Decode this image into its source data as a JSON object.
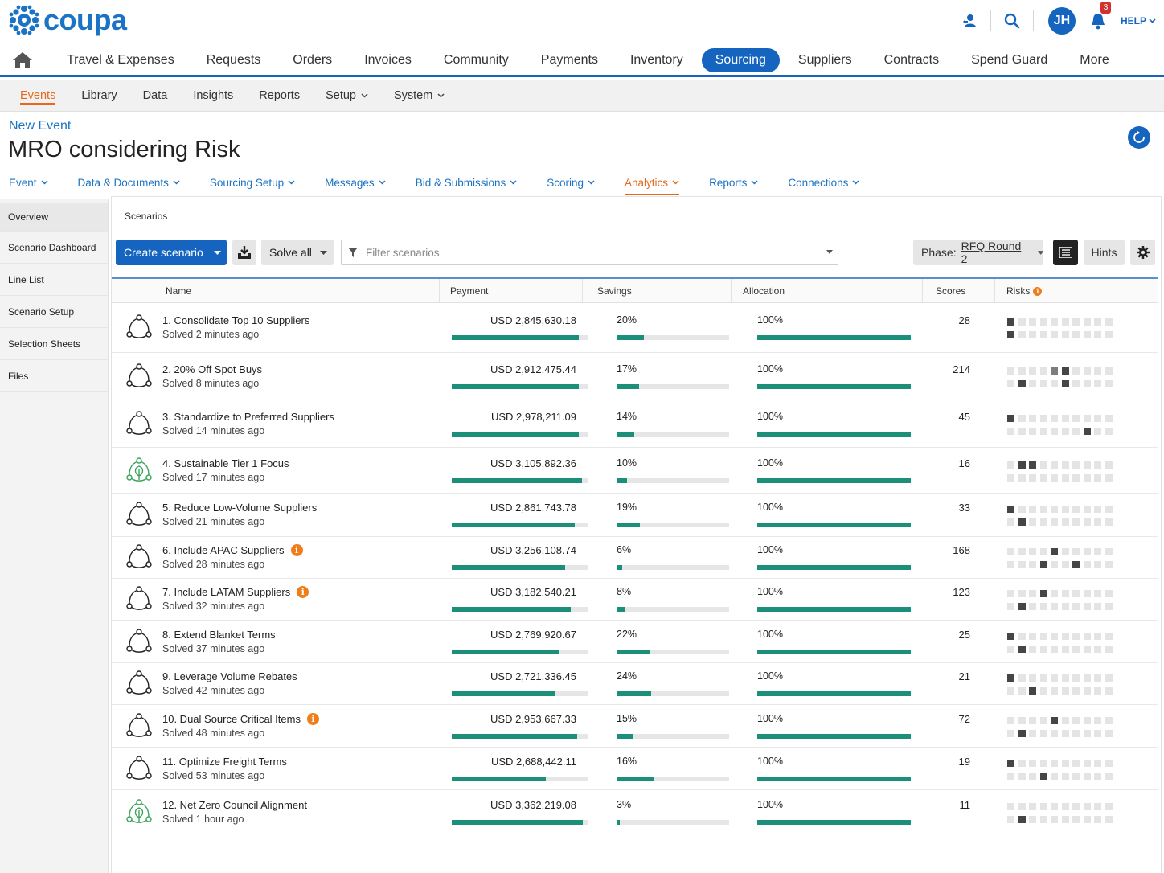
{
  "app": {
    "logo_text": "coupa",
    "help_label": "HELP",
    "avatar_initials": "JH",
    "notification_count": "3"
  },
  "colors": {
    "brand": "#1565c0",
    "accent": "#e66a1e",
    "bar": "#1b8f7a",
    "warn": "#ef7d1a"
  },
  "main_nav": {
    "items": [
      "Travel & Expenses",
      "Requests",
      "Orders",
      "Invoices",
      "Community",
      "Payments",
      "Inventory",
      "Sourcing",
      "Suppliers",
      "Contracts",
      "Spend Guard",
      "More"
    ],
    "active": "Sourcing"
  },
  "sub_nav": {
    "items": [
      {
        "label": "Events",
        "dropdown": false
      },
      {
        "label": "Library",
        "dropdown": false
      },
      {
        "label": "Data",
        "dropdown": false
      },
      {
        "label": "Insights",
        "dropdown": false
      },
      {
        "label": "Reports",
        "dropdown": false
      },
      {
        "label": "Setup",
        "dropdown": true
      },
      {
        "label": "System",
        "dropdown": true
      }
    ],
    "active": "Events"
  },
  "page": {
    "breadcrumb": "New Event",
    "title": "MRO considering Risk"
  },
  "event_nav": {
    "items": [
      "Event",
      "Data & Documents",
      "Sourcing Setup",
      "Messages",
      "Bid & Submissions",
      "Scoring",
      "Analytics",
      "Reports",
      "Connections"
    ],
    "active": "Analytics"
  },
  "sidebar": {
    "items": [
      "Overview",
      "Scenario Dashboard",
      "Line List",
      "Scenario Setup",
      "Selection Sheets",
      "Files"
    ]
  },
  "panel": {
    "title": "Scenarios",
    "create_label": "Create scenario",
    "solve_label": "Solve all",
    "filter_placeholder": "Filter scenarios",
    "phase_label": "Phase:",
    "phase_value": "RFQ Round 2",
    "hints_label": "Hints"
  },
  "table": {
    "columns": {
      "name": "Name",
      "payment": "Payment",
      "savings": "Savings",
      "allocation": "Allocation",
      "scores": "Scores",
      "risks": "Risks"
    },
    "rows": [
      {
        "name": "1. Consolidate Top 10 Suppliers",
        "solved": "Solved 2 minutes ago",
        "icon": "scenario-network-icon",
        "warning": false,
        "payment": "USD 2,845,630.18",
        "payment_fill": 0.93,
        "savings": "20%",
        "savings_fill": 0.24,
        "allocation": "100%",
        "score": "28",
        "risks": [
          [
            2,
            0,
            0,
            0,
            0,
            0,
            0,
            0,
            0,
            0
          ],
          [
            2,
            0,
            0,
            0,
            0,
            0,
            0,
            0,
            0,
            0
          ]
        ]
      },
      {
        "name": "2. 20% Off Spot Buys",
        "solved": "Solved 8 minutes ago",
        "icon": "scenario-network-icon",
        "warning": false,
        "payment": "USD 2,912,475.44",
        "payment_fill": 0.93,
        "savings": "17%",
        "savings_fill": 0.2,
        "allocation": "100%",
        "score": "214",
        "risks": [
          [
            0,
            0,
            0,
            0,
            1,
            2,
            0,
            0,
            0,
            0
          ],
          [
            0,
            2,
            0,
            0,
            0,
            2,
            0,
            0,
            0,
            0
          ]
        ]
      },
      {
        "name": "3. Standardize to Preferred Suppliers",
        "solved": "Solved 14 minutes ago",
        "icon": "scenario-network-icon",
        "warning": false,
        "payment": "USD 2,978,211.09",
        "payment_fill": 0.93,
        "savings": "14%",
        "savings_fill": 0.16,
        "allocation": "100%",
        "score": "45",
        "risks": [
          [
            2,
            0,
            0,
            0,
            0,
            0,
            0,
            0,
            0,
            0
          ],
          [
            0,
            0,
            0,
            0,
            0,
            0,
            0,
            2,
            0,
            0
          ]
        ]
      },
      {
        "name": "4. Sustainable Tier 1 Focus",
        "solved": "Solved 17 minutes ago",
        "icon": "scenario-eco-icon",
        "warning": false,
        "payment": "USD 3,105,892.36",
        "payment_fill": 0.95,
        "savings": "10%",
        "savings_fill": 0.09,
        "allocation": "100%",
        "score": "16",
        "risks": [
          [
            0,
            2,
            2,
            0,
            0,
            0,
            0,
            0,
            0,
            0
          ],
          [
            0,
            0,
            0,
            0,
            0,
            0,
            0,
            0,
            0,
            0
          ]
        ]
      },
      {
        "name": "5. Reduce Low-Volume Suppliers",
        "solved": "Solved 21 minutes ago",
        "icon": "scenario-network-icon",
        "warning": false,
        "payment": "USD 2,861,743.78",
        "payment_fill": 0.9,
        "savings": "19%",
        "savings_fill": 0.21,
        "allocation": "100%",
        "score": "33",
        "risks": [
          [
            2,
            0,
            0,
            0,
            0,
            0,
            0,
            0,
            0,
            0
          ],
          [
            0,
            2,
            0,
            0,
            0,
            0,
            0,
            0,
            0,
            0
          ]
        ]
      },
      {
        "name": "6. Include APAC Suppliers",
        "solved": "Solved 28 minutes ago",
        "icon": "scenario-network-icon",
        "warning": true,
        "payment": "USD 3,256,108.74",
        "payment_fill": 0.83,
        "savings": "6%",
        "savings_fill": 0.05,
        "allocation": "100%",
        "score": "168",
        "risks": [
          [
            0,
            0,
            0,
            0,
            2,
            0,
            0,
            0,
            0,
            0
          ],
          [
            0,
            0,
            0,
            2,
            0,
            0,
            2,
            0,
            0,
            0
          ]
        ]
      },
      {
        "name": "7. Include LATAM Suppliers",
        "solved": "Solved 32 minutes ago",
        "icon": "scenario-network-icon",
        "warning": true,
        "payment": "USD 3,182,540.21",
        "payment_fill": 0.87,
        "savings": "8%",
        "savings_fill": 0.07,
        "allocation": "100%",
        "score": "123",
        "risks": [
          [
            0,
            0,
            0,
            2,
            0,
            0,
            0,
            0,
            0,
            0
          ],
          [
            0,
            2,
            0,
            0,
            0,
            0,
            0,
            0,
            0,
            0
          ]
        ]
      },
      {
        "name": "8. Extend Blanket Terms",
        "solved": "Solved 37 minutes ago",
        "icon": "scenario-network-icon",
        "warning": false,
        "payment": "USD 2,769,920.67",
        "payment_fill": 0.78,
        "savings": "22%",
        "savings_fill": 0.3,
        "allocation": "100%",
        "score": "25",
        "risks": [
          [
            2,
            0,
            0,
            0,
            0,
            0,
            0,
            0,
            0,
            0
          ],
          [
            0,
            2,
            0,
            0,
            0,
            0,
            0,
            0,
            0,
            0
          ]
        ]
      },
      {
        "name": "9. Leverage Volume Rebates",
        "solved": "Solved 42 minutes ago",
        "icon": "scenario-network-icon",
        "warning": false,
        "payment": "USD 2,721,336.45",
        "payment_fill": 0.76,
        "savings": "24%",
        "savings_fill": 0.31,
        "allocation": "100%",
        "score": "21",
        "risks": [
          [
            2,
            0,
            0,
            0,
            0,
            0,
            0,
            0,
            0,
            0
          ],
          [
            0,
            0,
            2,
            0,
            0,
            0,
            0,
            0,
            0,
            0
          ]
        ]
      },
      {
        "name": "10. Dual Source Critical Items",
        "solved": "Solved 48 minutes ago",
        "icon": "scenario-network-icon",
        "warning": true,
        "payment": "USD 2,953,667.33",
        "payment_fill": 0.92,
        "savings": "15%",
        "savings_fill": 0.15,
        "allocation": "100%",
        "score": "72",
        "risks": [
          [
            0,
            0,
            0,
            0,
            2,
            0,
            0,
            0,
            0,
            0
          ],
          [
            0,
            2,
            0,
            0,
            0,
            0,
            0,
            0,
            0,
            0
          ]
        ]
      },
      {
        "name": "11. Optimize Freight Terms",
        "solved": "Solved 53 minutes ago",
        "icon": "scenario-network-icon",
        "warning": false,
        "payment": "USD 2,688,442.11",
        "payment_fill": 0.69,
        "savings": "16%",
        "savings_fill": 0.33,
        "allocation": "100%",
        "score": "19",
        "risks": [
          [
            2,
            0,
            0,
            0,
            0,
            0,
            0,
            0,
            0,
            0
          ],
          [
            0,
            0,
            0,
            2,
            0,
            0,
            0,
            0,
            0,
            0
          ]
        ]
      },
      {
        "name": "12. Net Zero Council Alignment",
        "solved": "Solved 1 hour ago",
        "icon": "scenario-eco-icon",
        "warning": false,
        "payment": "USD 3,362,219.08",
        "payment_fill": 0.96,
        "savings": "3%",
        "savings_fill": 0.03,
        "allocation": "100%",
        "score": "11",
        "risks": [
          [
            0,
            0,
            0,
            0,
            0,
            0,
            0,
            0,
            0,
            0
          ],
          [
            0,
            2,
            0,
            0,
            0,
            0,
            0,
            0,
            0,
            0
          ]
        ]
      }
    ]
  }
}
